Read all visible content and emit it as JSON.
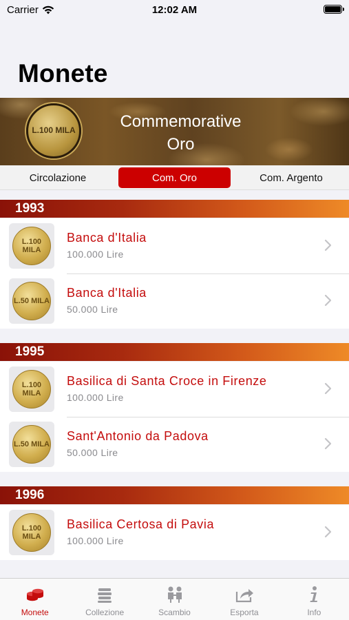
{
  "status_bar": {
    "carrier": "Carrier",
    "time": "12:02 AM"
  },
  "page_title": "Monete",
  "banner": {
    "line1": "Commemorative",
    "line2": "Oro",
    "coin_text": "L.100 MILA"
  },
  "segments": [
    {
      "label": "Circolazione",
      "active": false
    },
    {
      "label": "Com. Oro",
      "active": true
    },
    {
      "label": "Com. Argento",
      "active": false
    }
  ],
  "sections": [
    {
      "year": "1993",
      "items": [
        {
          "name": "Banca d'Italia",
          "value": "100.000 Lire",
          "coin_text": "L.100 MILA"
        },
        {
          "name": "Banca d'Italia",
          "value": "50.000 Lire",
          "coin_text": "L.50 MILA"
        }
      ]
    },
    {
      "year": "1995",
      "items": [
        {
          "name": "Basilica di Santa Croce in Firenze",
          "value": "100.000 Lire",
          "coin_text": "L.100 MILA"
        },
        {
          "name": "Sant'Antonio da Padova",
          "value": "50.000 Lire",
          "coin_text": "L.50 MILA"
        }
      ]
    },
    {
      "year": "1996",
      "items": [
        {
          "name": "Basilica Certosa di Pavia",
          "value": "100.000 Lire",
          "coin_text": "L.100 MILA"
        }
      ]
    }
  ],
  "tabs": [
    {
      "label": "Monete",
      "icon": "coins-icon",
      "active": true
    },
    {
      "label": "Collezione",
      "icon": "stack-icon",
      "active": false
    },
    {
      "label": "Scambio",
      "icon": "exchange-icon",
      "active": false
    },
    {
      "label": "Esporta",
      "icon": "share-icon",
      "active": false
    },
    {
      "label": "Info",
      "icon": "info-icon",
      "active": false
    }
  ],
  "colors": {
    "accent": "#c40d0d",
    "segment_active": "#cc0000",
    "header_start": "#8a1208",
    "header_end": "#ee8a27",
    "inactive_tab": "#8e8e93"
  }
}
